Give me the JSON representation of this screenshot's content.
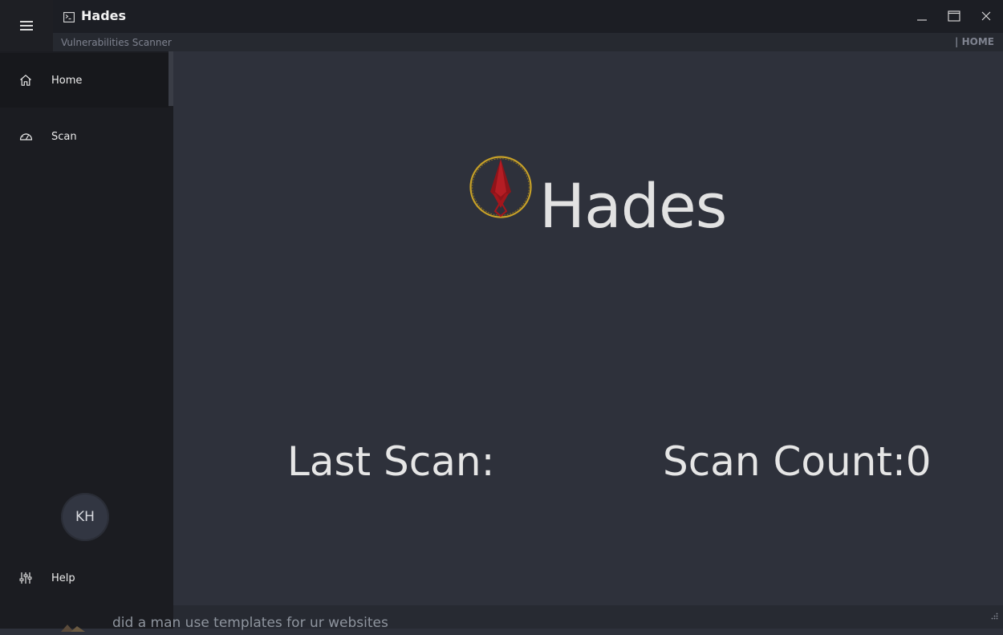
{
  "window": {
    "title": "Hades",
    "subtitle": "Vulnerabilities Scanner",
    "breadcrumb": "| HOME",
    "controls": [
      "minimize-icon",
      "maximize-icon",
      "close-icon"
    ]
  },
  "sidebar": {
    "menu_icon": "hamburger-icon",
    "items": [
      {
        "label": "Home",
        "icon": "home-icon",
        "active": true
      },
      {
        "label": "Scan",
        "icon": "speedometer-icon",
        "active": false
      }
    ],
    "avatar_initials": "KH",
    "help": {
      "label": "Help",
      "icon": "sliders-icon"
    }
  },
  "main": {
    "brand_name": "Hades",
    "last_scan_label": "Last Scan:",
    "scan_count_label": "Scan Count:0"
  },
  "background_text": "did a man use templates for ur websites",
  "colors": {
    "sidebar_bg": "#1b1c21",
    "content_bg": "#2e313b",
    "titlebar_bg": "#1c1e24",
    "logo_ring": "#c9a227",
    "logo_blade": "#a3161c"
  }
}
